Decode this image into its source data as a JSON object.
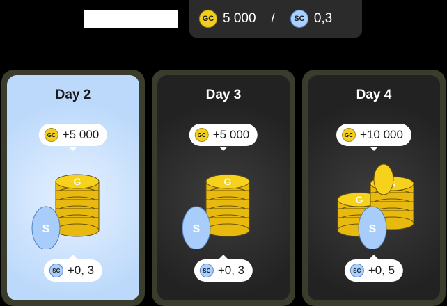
{
  "balance": {
    "gc_icon": "GC",
    "gc_value": "5 000",
    "separator": "/",
    "sc_icon": "SC",
    "sc_value": "0,3"
  },
  "cards": [
    {
      "title": "Day 2",
      "gc_reward": "+5 000",
      "sc_reward": "+0, 3",
      "state": "active"
    },
    {
      "title": "Day 3",
      "gc_reward": "+5 000",
      "sc_reward": "+0, 3",
      "state": "locked"
    },
    {
      "title": "Day 4",
      "gc_reward": "+10 000",
      "sc_reward": "+0, 5",
      "state": "locked"
    }
  ],
  "colors": {
    "gold": "#f2cf1c",
    "silver_blue": "#a9d0ff",
    "active_bg": "#bcd9fb",
    "card_border": "#3a3d2c"
  }
}
